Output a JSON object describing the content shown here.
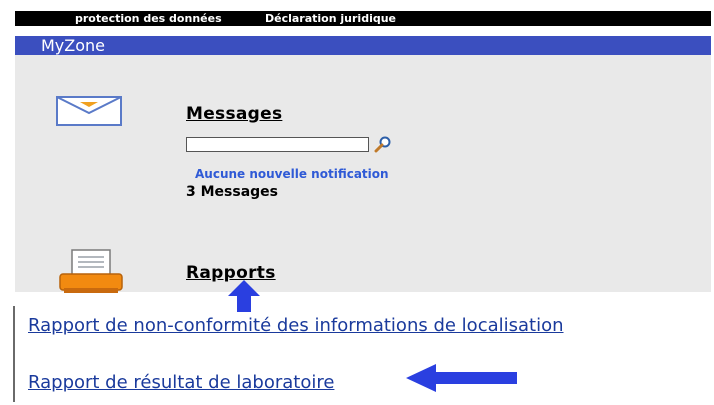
{
  "topbar": {
    "item1": "protection des données",
    "item2": "Déclaration juridique"
  },
  "zone": {
    "title": "MyZone"
  },
  "messages": {
    "title": "Messages",
    "search_value": "",
    "notification": "Aucune nouvelle notification",
    "count_text": "3 Messages"
  },
  "reports": {
    "title": "Rapports"
  },
  "links": [
    "Rapport de non-conformité des informations de localisation",
    "Rapport de résultat de laboratoire"
  ],
  "colors": {
    "band": "#3b4fbf",
    "panel": "#e9e9e9",
    "notification": "#2f5ad6",
    "link": "#1a3a9c",
    "arrow": "#2a3fe0"
  },
  "icons": [
    "envelope-icon",
    "search-icon",
    "printer-icon",
    "arrow-up-icon",
    "arrow-left-icon"
  ]
}
